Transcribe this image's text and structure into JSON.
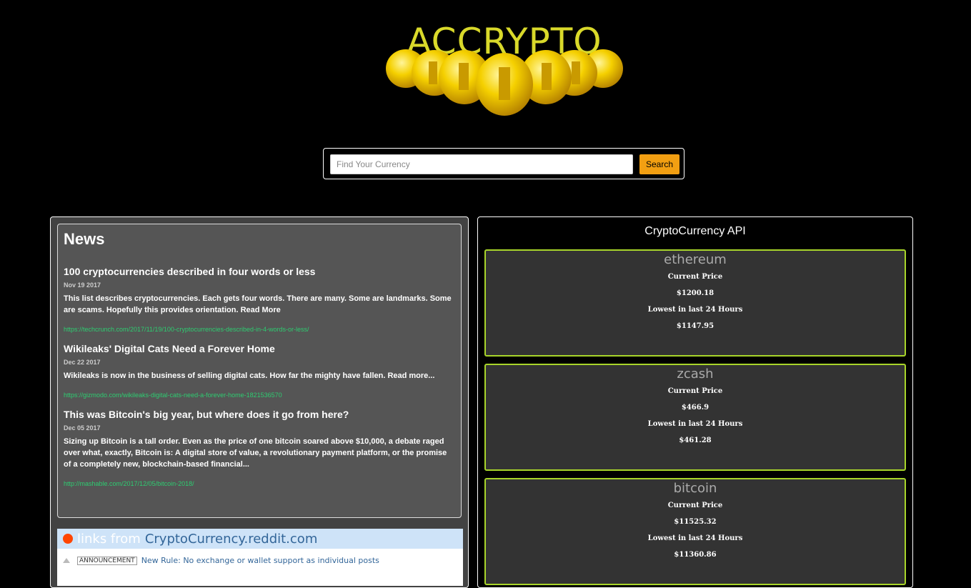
{
  "logo": {
    "text": "ACCRYPTO",
    "color": "#d9d92a",
    "icon": "gold-coins-icon"
  },
  "search": {
    "placeholder": "Find Your Currency",
    "button_label": "Search",
    "accent": "#f29f12"
  },
  "news": {
    "heading": "News",
    "articles": [
      {
        "title": "100 cryptocurrencies described in four words or less",
        "date": "Nov 19 2017",
        "description": "This list describes cryptocurrencies. Each gets four words. There are many. Some are landmarks. Some are scams. Hopefully this provides orientation. Read More",
        "url": "https://techcrunch.com/2017/11/19/100-cryptocurrencies-described-in-4-words-or-less/"
      },
      {
        "title": "Wikileaks' Digital Cats Need a Forever Home",
        "date": "Dec 22 2017",
        "description": "Wikileaks is now in the business of selling digital cats. How far the mighty have fallen. Read more...",
        "url": "https://gizmodo.com/wikileaks-digital-cats-need-a-forever-home-1821536570"
      },
      {
        "title": "This was Bitcoin's big year, but where does it go from here?",
        "date": "Dec 05 2017",
        "description": "Sizing up Bitcoin is a tall order. Even as the price of one bitcoin soared above $10,000, a debate raged over what, exactly, Bitcoin is: A digital store of value, a revolutionary payment platform, or the promise of a completely new, blockchain-based financial...",
        "url": "http://mashable.com/2017/12/05/bitcoin-2018/"
      }
    ]
  },
  "reddit": {
    "header_prefix": "links from",
    "subreddit": "CryptoCurrency.reddit.com",
    "badge": "ANNOUNCEMENT",
    "post_title": "New Rule: No exchange or wallet support as individual posts"
  },
  "api": {
    "title": "CryptoCurrency API",
    "price_label": "Current Price",
    "low_label": "Lowest in last 24 Hours",
    "coins": [
      {
        "name": "ethereum",
        "price": "$1200.18",
        "low": "$1147.95"
      },
      {
        "name": "zcash",
        "price": "$466.9",
        "low": "$461.28"
      },
      {
        "name": "bitcoin",
        "price": "$11525.32",
        "low": "$11360.86"
      }
    ],
    "card_border_color": "#a8d52a"
  }
}
